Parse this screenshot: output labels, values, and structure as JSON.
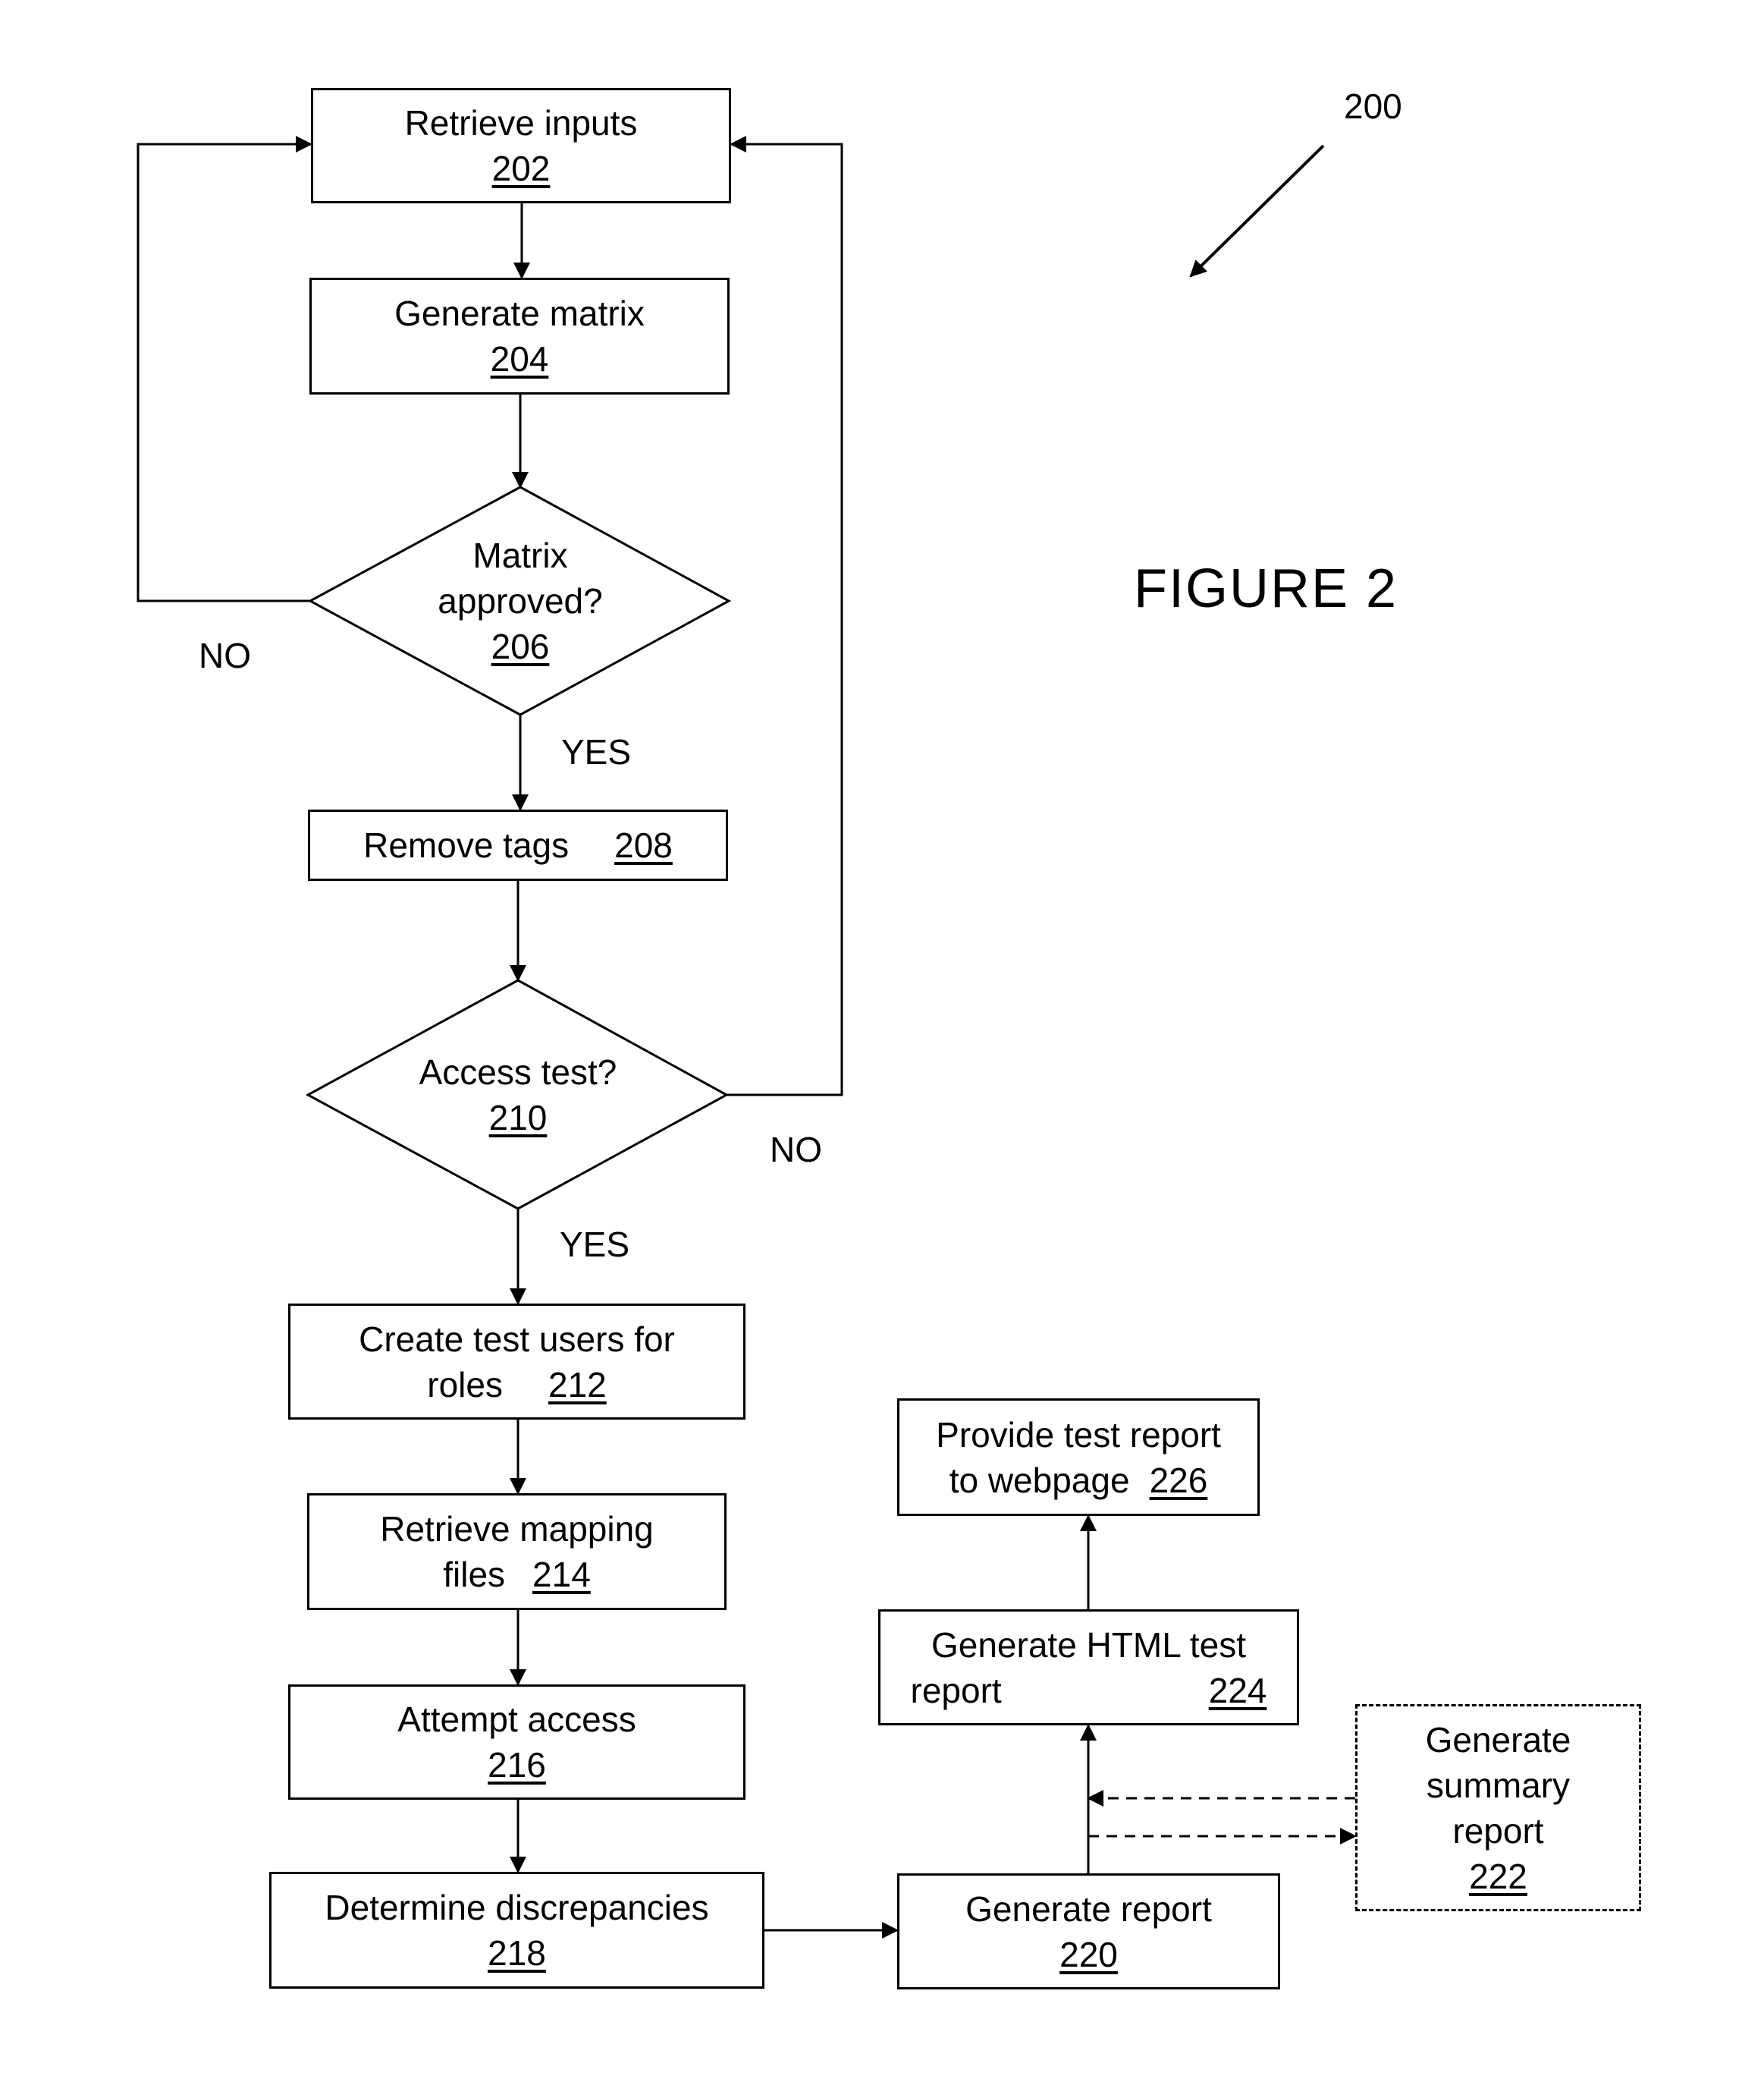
{
  "figure": {
    "title": "FIGURE 2",
    "reference": "200"
  },
  "steps": {
    "s202": {
      "text": "Retrieve inputs",
      "ref": "202"
    },
    "s204": {
      "text": "Generate matrix",
      "ref": "204"
    },
    "s206": {
      "line1": "Matrix",
      "line2": "approved?",
      "ref": "206"
    },
    "s208": {
      "text": "Remove tags",
      "ref": "208"
    },
    "s210": {
      "text": "Access test?",
      "ref": "210"
    },
    "s212": {
      "line1": "Create test users for",
      "line2": "roles",
      "ref": "212"
    },
    "s214": {
      "line1": "Retrieve mapping",
      "line2": "files",
      "ref": "214"
    },
    "s216": {
      "text": "Attempt access",
      "ref": "216"
    },
    "s218": {
      "text": "Determine discrepancies",
      "ref": "218"
    },
    "s220": {
      "text": "Generate report",
      "ref": "220"
    },
    "s222": {
      "line1": "Generate",
      "line2": "summary",
      "line3": "report",
      "ref": "222"
    },
    "s224": {
      "line1": "Generate HTML test",
      "line2": "report",
      "ref": "224"
    },
    "s226": {
      "line1": "Provide test report",
      "line2": "to webpage",
      "ref": "226"
    }
  },
  "branch_labels": {
    "d206_no": "NO",
    "d206_yes": "YES",
    "d210_no": "NO",
    "d210_yes": "YES"
  }
}
